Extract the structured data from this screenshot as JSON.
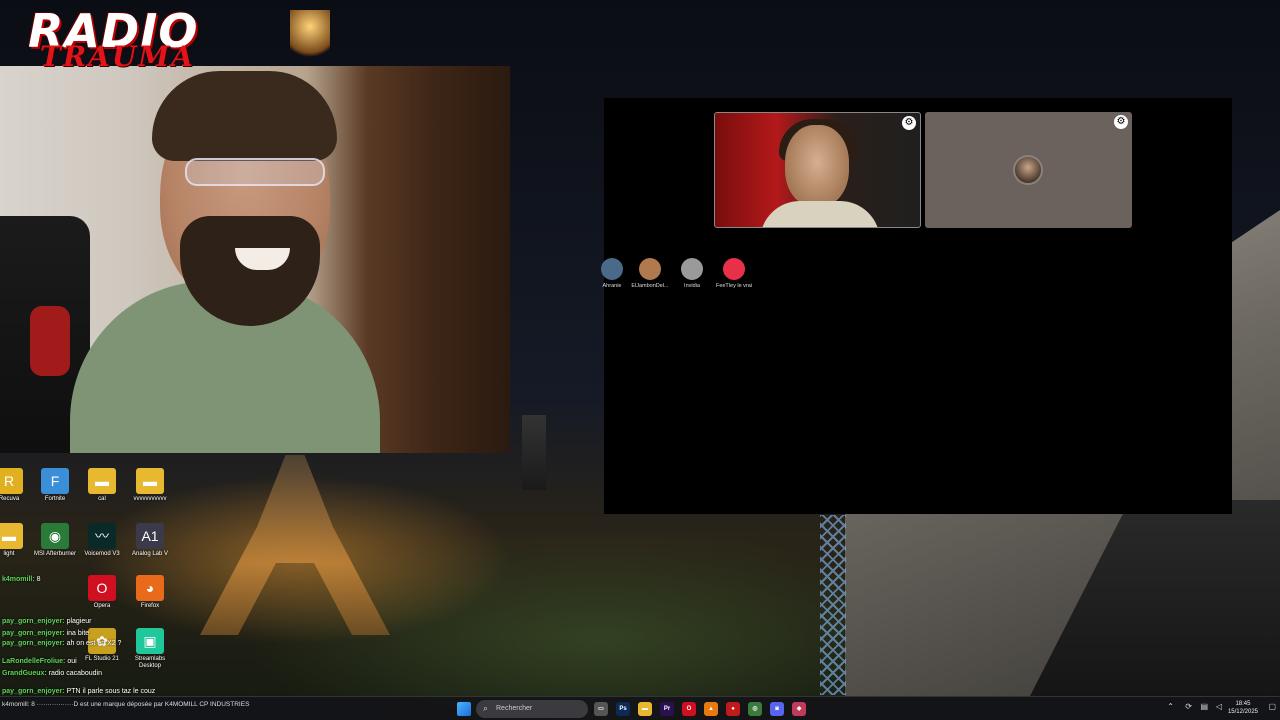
{
  "logo": {
    "line1": "RADIO",
    "line2": "TRAUMA"
  },
  "call": {
    "participants": [
      {
        "name": "Ahranie",
        "color": "#4a6a8a"
      },
      {
        "name": "ElJambonDel...",
        "color": "#b0794e"
      },
      {
        "name": "Invidia",
        "color": "#9a9a9a"
      },
      {
        "name": "FeeTley le vrai",
        "color": "#e8304a"
      }
    ],
    "tile_button_icon": "settings-icon"
  },
  "desktop_icons": [
    {
      "label": "Recuva",
      "color": "#e0b020",
      "glyph": "R"
    },
    {
      "label": "Fortnite",
      "color": "#3a8fd8",
      "glyph": "F"
    },
    {
      "label": "cal",
      "color": "#e8b830",
      "glyph": "▬"
    },
    {
      "label": "vvvvvvvvvvv",
      "color": "#e8b830",
      "glyph": "▬"
    },
    {
      "label": "light",
      "color": "#e8b830",
      "glyph": "▬"
    },
    {
      "label": "MSI Afterburner",
      "color": "#2a7a3a",
      "glyph": "◉"
    },
    {
      "label": "Voicemod V3",
      "color": "#0a2a2a",
      "glyph": "〰"
    },
    {
      "label": "Analog Lab V",
      "color": "#3a3a4a",
      "glyph": "A1"
    },
    {
      "label": "Opera",
      "color": "#d01020",
      "glyph": "O"
    },
    {
      "label": "Firefox",
      "color": "#e86a1a",
      "glyph": "◕"
    },
    {
      "label": "FL Studio 21",
      "color": "#c8a020",
      "glyph": "✿"
    },
    {
      "label": "Streamlabs Desktop",
      "color": "#1fc79a",
      "glyph": "▣"
    }
  ],
  "chat": [
    {
      "user": "k4momill:",
      "msg": "8"
    },
    {
      "user": "pay_gorn_enjoyer:",
      "msg": "plagieur"
    },
    {
      "user": "pay_gorn_enjoyer:",
      "msg": "ina bite"
    },
    {
      "user": "pay_gorn_enjoyer:",
      "msg": "ah on est en X2 ?"
    },
    {
      "user": "LaRondelleFroliue:",
      "msg": "oui"
    },
    {
      "user": "GrandGueux:",
      "msg": "radio cacaboudin"
    },
    {
      "user": "pay_gorn_enjoyer:",
      "msg": "PTN il parle sous taz le couz"
    }
  ],
  "taskbar": {
    "left_text": "k4momill: 8 ·················D est une marque déposée par K4MOMILL CP INDUSTRIES",
    "search_placeholder": "Rechercher",
    "search_icon": "search-icon",
    "apps": [
      {
        "name": "files-icon",
        "glyph": "▭",
        "color": "#555"
      },
      {
        "name": "photoshop-icon",
        "glyph": "Ps",
        "color": "#0b2a55"
      },
      {
        "name": "explorer-icon",
        "glyph": "▬",
        "color": "#e8b830"
      },
      {
        "name": "premiere-icon",
        "glyph": "Pr",
        "color": "#2a1050"
      },
      {
        "name": "opera-icon",
        "glyph": "O",
        "color": "#d01020"
      },
      {
        "name": "vlc-icon",
        "glyph": "▲",
        "color": "#e87a10"
      },
      {
        "name": "recorder-icon",
        "glyph": "●",
        "color": "#c01a1a"
      },
      {
        "name": "chrome-icon",
        "glyph": "◎",
        "color": "#3a7a3a"
      },
      {
        "name": "discord-icon",
        "glyph": "◙",
        "color": "#5865f2"
      },
      {
        "name": "app-icon",
        "glyph": "◆",
        "color": "#c03a5a"
      }
    ],
    "time": "18:45",
    "date": "15/12/2025"
  }
}
